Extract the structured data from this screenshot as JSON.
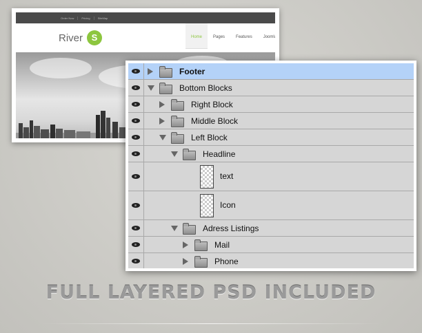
{
  "preview": {
    "topbar_links": [
      "Order Now",
      "Pricing",
      "SiteMap"
    ],
    "logo_text": "River",
    "logo_badge": "S",
    "nav": [
      {
        "label": "Home",
        "active": true
      },
      {
        "label": "Pages",
        "active": false
      },
      {
        "label": "Features",
        "active": false
      },
      {
        "label": "Joomla",
        "active": false
      }
    ]
  },
  "layers": [
    {
      "name": "Footer",
      "selected": true,
      "bold": true,
      "expand": "right",
      "kind": "folder",
      "indent": 0
    },
    {
      "name": "Bottom Blocks",
      "selected": false,
      "bold": false,
      "expand": "down",
      "kind": "folder",
      "indent": 0
    },
    {
      "name": "Right Block",
      "selected": false,
      "bold": false,
      "expand": "right",
      "kind": "folder",
      "indent": 1
    },
    {
      "name": "Middle Block",
      "selected": false,
      "bold": false,
      "expand": "right",
      "kind": "folder",
      "indent": 1
    },
    {
      "name": "Left Block",
      "selected": false,
      "bold": false,
      "expand": "down",
      "kind": "folder",
      "indent": 1
    },
    {
      "name": "Headline",
      "selected": false,
      "bold": false,
      "expand": "down",
      "kind": "folder",
      "indent": 2
    },
    {
      "name": "text",
      "selected": false,
      "bold": false,
      "expand": "none",
      "kind": "layer",
      "indent": 3
    },
    {
      "name": "Icon",
      "selected": false,
      "bold": false,
      "expand": "none",
      "kind": "layer",
      "indent": 3
    },
    {
      "name": "Adress Listings",
      "selected": false,
      "bold": false,
      "expand": "down",
      "kind": "folder",
      "indent": 2
    },
    {
      "name": "Mail",
      "selected": false,
      "bold": false,
      "expand": "right",
      "kind": "folder",
      "indent": 3
    },
    {
      "name": "Phone",
      "selected": false,
      "bold": false,
      "expand": "right",
      "kind": "folder",
      "indent": 3
    }
  ],
  "headline": "FULL LAYERED PSD INCLUDED",
  "colors": {
    "accent": "#8dc63f",
    "selection": "#b4d2f8",
    "panel_bg": "#d6d6d6"
  }
}
